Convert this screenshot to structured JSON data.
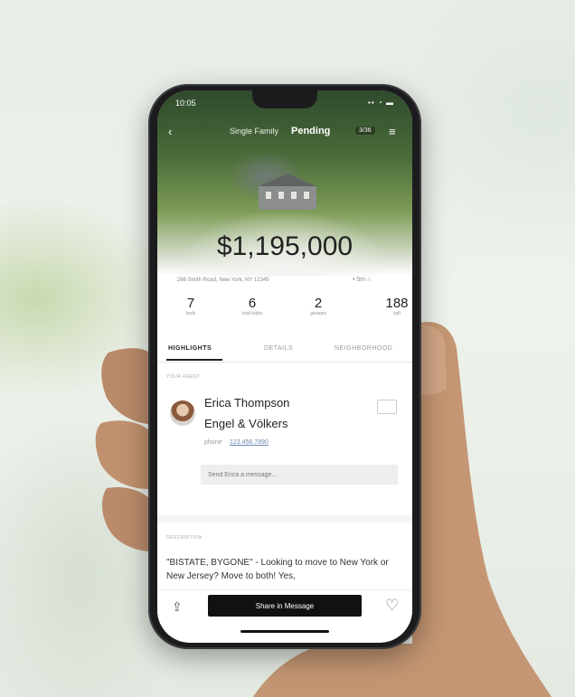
{
  "status": {
    "time": "10:05",
    "icons": "▪▪ ◔ ▬"
  },
  "header": {
    "back_glyph": "‹",
    "property_type": "Single Family",
    "status": "Pending",
    "badge": "3/36",
    "menu_glyph": "≡"
  },
  "listing": {
    "price": "$1,195,000",
    "address": "266 Smith Road, New York, NY 12345",
    "meta": "• 5m ⌂"
  },
  "stats": [
    {
      "value": "7",
      "label": "beds"
    },
    {
      "value": "6",
      "label": "total baths"
    },
    {
      "value": "2",
      "label": "garages"
    },
    {
      "value": "188",
      "label": "sqft"
    }
  ],
  "tabs": [
    {
      "label": "HIGHLIGHTS",
      "active": true
    },
    {
      "label": "DETAILS",
      "active": false
    },
    {
      "label": "NEIGHBORHOOD",
      "active": false
    }
  ],
  "agent": {
    "section_label": "YOUR AGENT",
    "name": "Erica Thompson",
    "company": "Engel & Völkers",
    "phone_label": "phone",
    "phone": "123.456.7890",
    "message_placeholder": "Send Erica a message..."
  },
  "description": {
    "section_label": "DESCRIPTION",
    "text": "\"BISTATE, BYGONE\" - Looking to move to New York or New Jersey? Move to both! Yes,"
  },
  "actions": {
    "share_label": "Share in Message",
    "share_glyph": "⇪",
    "favorite_glyph": "♡"
  }
}
